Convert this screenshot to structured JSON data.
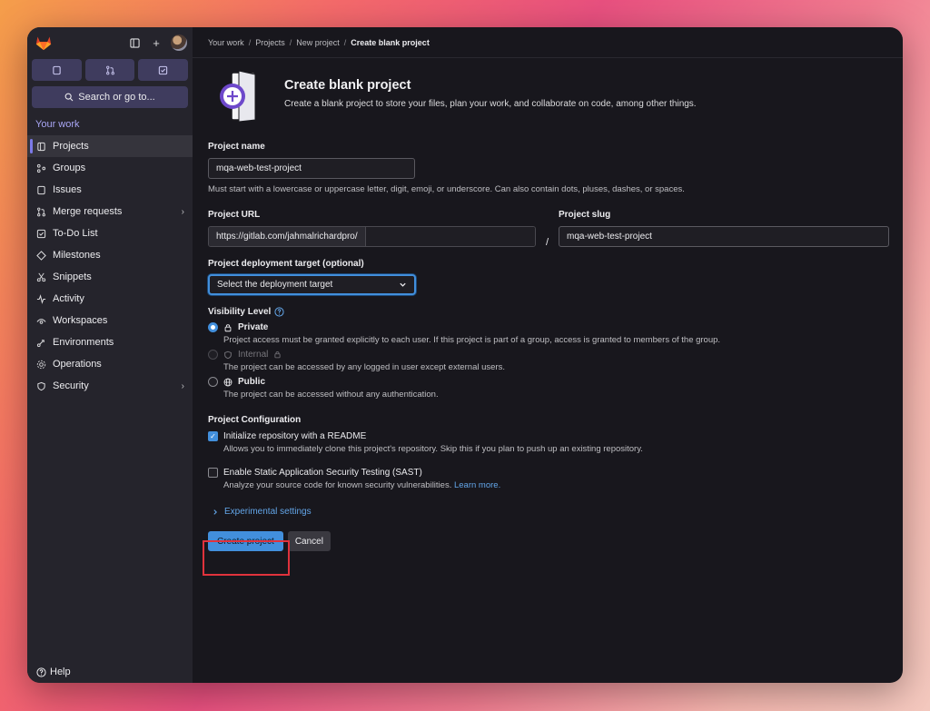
{
  "sidebar": {
    "search_label": "Search or go to...",
    "section": "Your work",
    "items": [
      {
        "label": "Projects",
        "icon": "project-icon",
        "active": true,
        "chevron": false
      },
      {
        "label": "Groups",
        "icon": "group-icon",
        "active": false,
        "chevron": false
      },
      {
        "label": "Issues",
        "icon": "issues-icon",
        "active": false,
        "chevron": false
      },
      {
        "label": "Merge requests",
        "icon": "merge-request-icon",
        "active": false,
        "chevron": true
      },
      {
        "label": "To-Do List",
        "icon": "todo-icon",
        "active": false,
        "chevron": false
      },
      {
        "label": "Milestones",
        "icon": "milestone-icon",
        "active": false,
        "chevron": false
      },
      {
        "label": "Snippets",
        "icon": "snippet-icon",
        "active": false,
        "chevron": false
      },
      {
        "label": "Activity",
        "icon": "activity-icon",
        "active": false,
        "chevron": false
      },
      {
        "label": "Workspaces",
        "icon": "workspace-icon",
        "active": false,
        "chevron": false
      },
      {
        "label": "Environments",
        "icon": "environment-icon",
        "active": false,
        "chevron": false
      },
      {
        "label": "Operations",
        "icon": "operations-icon",
        "active": false,
        "chevron": false
      },
      {
        "label": "Security",
        "icon": "shield-icon",
        "active": false,
        "chevron": true
      }
    ],
    "help_label": "Help"
  },
  "breadcrumb": [
    "Your work",
    "Projects",
    "New project",
    "Create blank project"
  ],
  "header": {
    "title": "Create blank project",
    "description": "Create a blank project to store your files, plan your work, and collaborate on code, among other things."
  },
  "form": {
    "project_name_label": "Project name",
    "project_name_value": "mqa-web-test-project",
    "project_name_help": "Must start with a lowercase or uppercase letter, digit, emoji, or underscore. Can also contain dots, pluses, dashes, or spaces.",
    "project_url_label": "Project URL",
    "project_url_prefix": "https://gitlab.com/jahmalrichardpro/",
    "slash": "/",
    "project_slug_label": "Project slug",
    "project_slug_value": "mqa-web-test-project",
    "deployment_label": "Project deployment target (optional)",
    "deployment_value": "Select the deployment target",
    "visibility_label": "Visibility Level",
    "visibility": [
      {
        "label": "Private",
        "desc": "Project access must be granted explicitly to each user. If this project is part of a group, access is granted to members of the group.",
        "checked": true,
        "disabled": false
      },
      {
        "label": "Internal",
        "desc": "The project can be accessed by any logged in user except external users.",
        "checked": false,
        "disabled": true
      },
      {
        "label": "Public",
        "desc": "The project can be accessed without any authentication.",
        "checked": false,
        "disabled": false
      }
    ],
    "config_label": "Project Configuration",
    "readme_label": "Initialize repository with a README",
    "readme_desc": "Allows you to immediately clone this project's repository. Skip this if you plan to push up an existing repository.",
    "sast_label": "Enable Static Application Security Testing (SAST)",
    "sast_desc": "Analyze your source code for known security vulnerabilities.",
    "sast_link": "Learn more.",
    "experimental_label": "Experimental settings",
    "create_label": "Create project",
    "cancel_label": "Cancel"
  },
  "colors": {
    "accent": "#428fdc",
    "highlight": "#e0323c",
    "sidebar_accent": "#a9a6f5"
  }
}
